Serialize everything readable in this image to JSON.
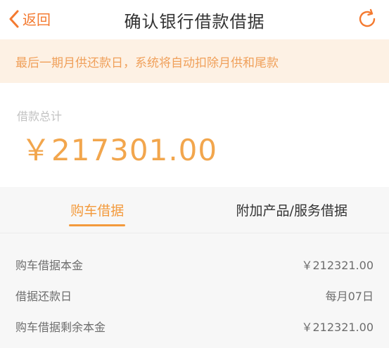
{
  "header": {
    "back_label": "返回",
    "title": "确认银行借款借据"
  },
  "notice": {
    "text": "最后一期月供还款日，系统将自动扣除月供和尾款"
  },
  "total": {
    "label": "借款总计",
    "amount": "￥217301.00"
  },
  "tabs": [
    {
      "label": "购车借据",
      "active": true
    },
    {
      "label": "附加产品/服务借据",
      "active": false
    }
  ],
  "details": [
    {
      "label": "购车借据本金",
      "value": "￥212321.00"
    },
    {
      "label": "借据还款日",
      "value": "每月07日"
    },
    {
      "label": "购车借据剩余本金",
      "value": "￥212321.00"
    }
  ],
  "colors": {
    "accent": "#f47a30",
    "amount": "#f2a64d",
    "notice_bg": "#fdf1e4",
    "notice_text": "#f0a05a"
  },
  "icons": {
    "back": "chevron-left-icon",
    "refresh": "refresh-icon"
  }
}
